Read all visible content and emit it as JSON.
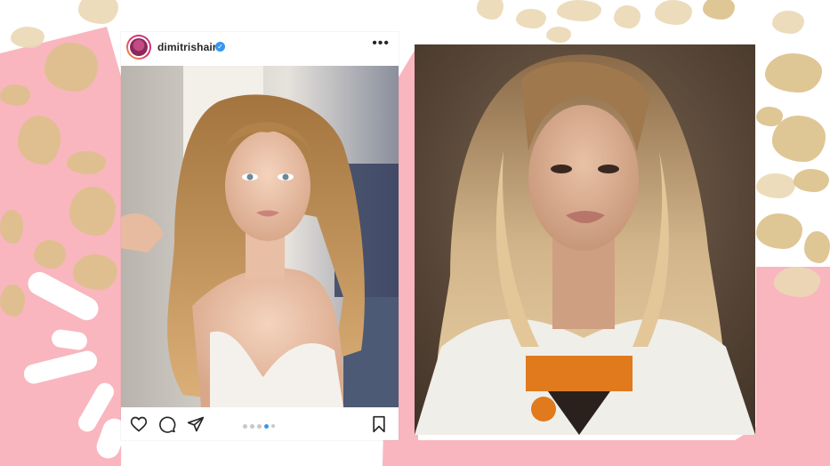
{
  "post": {
    "username": "dimitrishair",
    "verified": true,
    "more_icon": "more-horizontal-icon",
    "actions": [
      "heart-icon",
      "comment-icon",
      "share-icon",
      "bookmark-icon"
    ],
    "carousel": {
      "total": 5,
      "active_index": 3
    }
  },
  "colors": {
    "background_pink": "#f9b6bf",
    "leopard_gold": "#dcc08a",
    "instagram_blue": "#3897f0"
  }
}
